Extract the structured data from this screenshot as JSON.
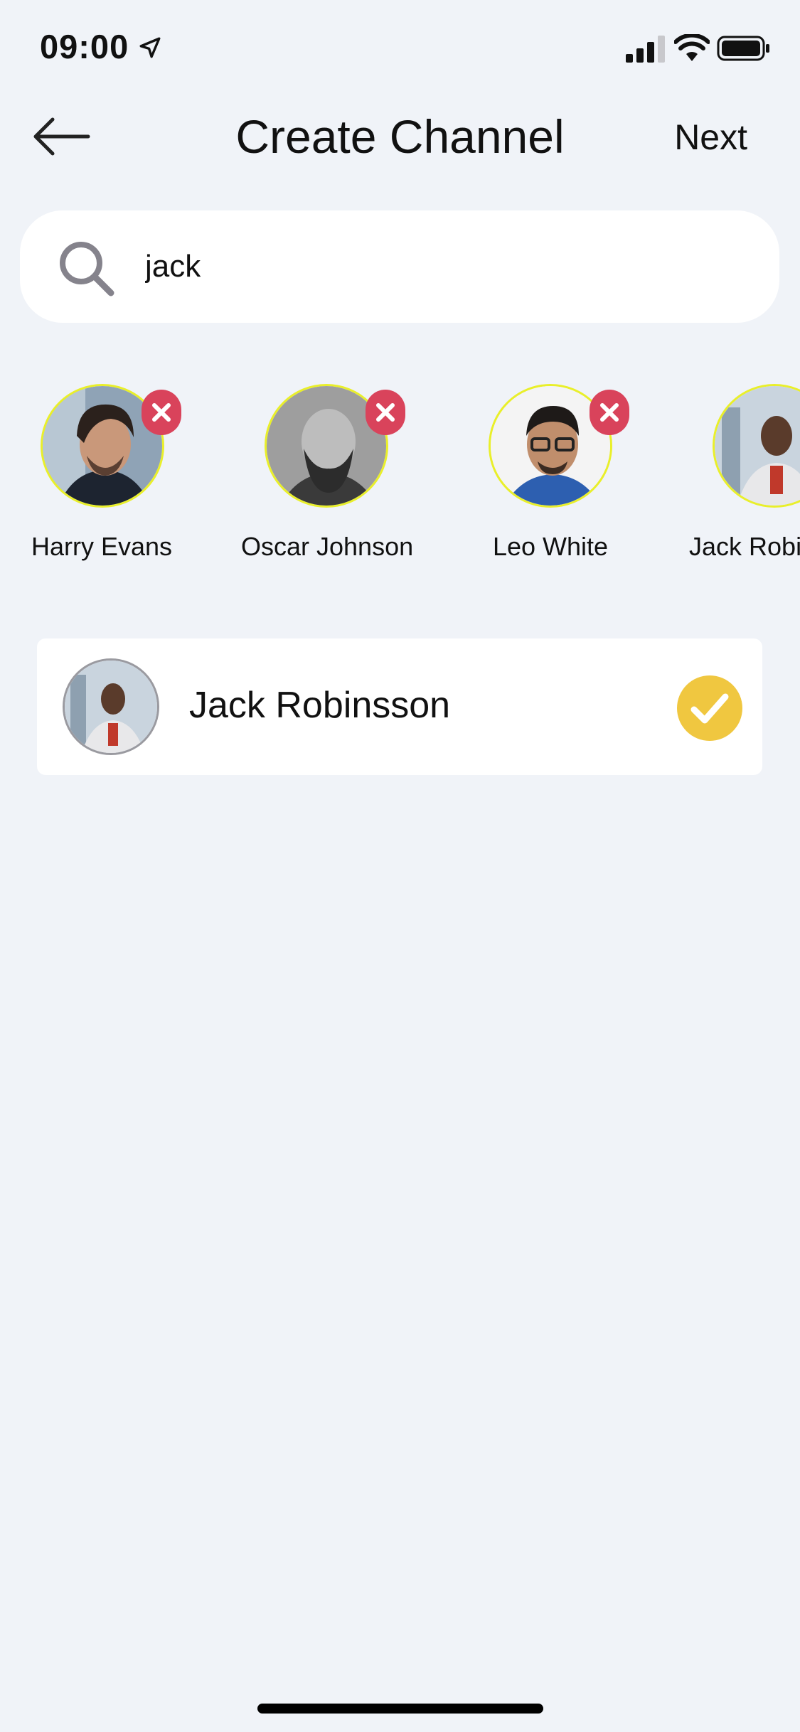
{
  "status_bar": {
    "time": "09:00"
  },
  "header": {
    "title": "Create Channel",
    "next_label": "Next"
  },
  "search": {
    "value": "jack"
  },
  "selected": [
    {
      "name": "Harry Evans"
    },
    {
      "name": "Oscar Johnson"
    },
    {
      "name": "Leo White"
    },
    {
      "name": "Jack Robinsson"
    }
  ],
  "results": [
    {
      "name": "Jack Robinsson",
      "checked": true
    }
  ],
  "colors": {
    "background": "#f0f3f8",
    "remove_badge": "#d9435b",
    "check_badge": "#f0c740",
    "avatar_ring": "#e9ef2a"
  }
}
